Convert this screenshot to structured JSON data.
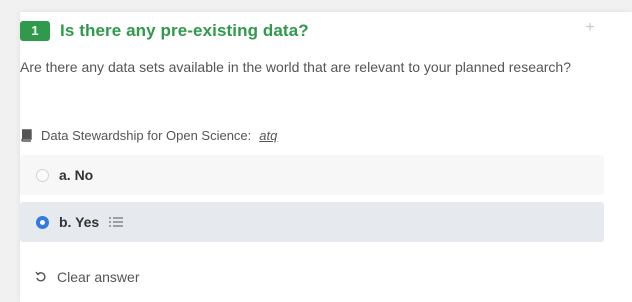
{
  "question": {
    "number": "1",
    "title": "Is there any pre-existing data?",
    "description": "Are there any data sets available in the world that are relevant to your planned research?",
    "reference_label": "Data Stewardship for Open Science:",
    "reference_link": "atq",
    "corner_icon": "plus-icon"
  },
  "answers": [
    {
      "label": "a. No",
      "selected": false
    },
    {
      "label": "b. Yes",
      "selected": true
    }
  ],
  "clear_label": "Clear answer",
  "colors": {
    "accent_green": "#2f9a4b",
    "radio_blue": "#2f7de1",
    "selected_bg": "#e6e9ed"
  }
}
